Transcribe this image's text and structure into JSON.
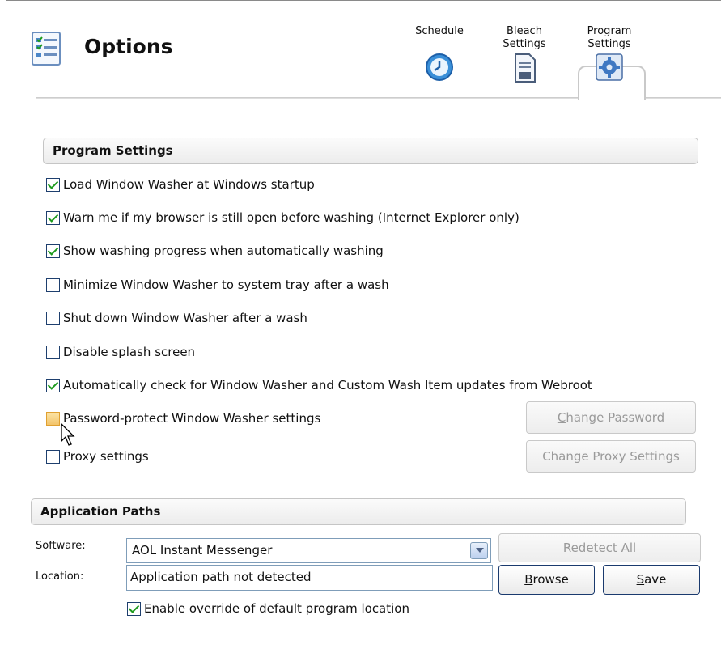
{
  "header": {
    "title": "Options",
    "icon": "options-list-icon"
  },
  "tabs": [
    {
      "label_line1": "Schedule",
      "label_line2": "",
      "icon": "clock-icon"
    },
    {
      "label_line1": "Bleach",
      "label_line2": "Settings",
      "icon": "document-icon"
    },
    {
      "label_line1": "Program",
      "label_line2": "Settings",
      "icon": "gear-icon",
      "selected": true
    }
  ],
  "program_settings": {
    "header": "Program Settings",
    "options": [
      {
        "label": "Load Window Washer at Windows startup",
        "checked": true
      },
      {
        "label": "Warn me if my browser is still open before washing (Internet Explorer only)",
        "checked": true
      },
      {
        "label": "Show washing progress when automatically washing",
        "checked": true
      },
      {
        "label": "Minimize Window Washer to system tray after a wash",
        "checked": false
      },
      {
        "label": "Shut down Window Washer after a wash",
        "checked": false
      },
      {
        "label": "Disable splash screen",
        "checked": false
      },
      {
        "label": "Automatically check for Window Washer and Custom Wash Item updates from Webroot",
        "checked": true
      },
      {
        "label": "Password-protect Window Washer settings",
        "checked": false
      },
      {
        "label": "Proxy settings",
        "checked": false
      }
    ],
    "change_password_button": {
      "access_key": "C",
      "rest": "hange Password"
    },
    "change_proxy_button": "Change Proxy Settings"
  },
  "application_paths": {
    "header": "Application Paths",
    "software_label": "Software:",
    "software_value": "AOL Instant Messenger",
    "location_label": "Location:",
    "location_value": "Application path not detected",
    "redetect_button": {
      "access_key": "R",
      "rest": "edetect All"
    },
    "browse_button": {
      "access_key": "B",
      "rest": "rowse"
    },
    "save_button": {
      "access_key": "S",
      "rest": "ave"
    },
    "override_label": "Enable override of default program location",
    "override_checked": true
  },
  "colors": {
    "checkmark": "#1e9b1e",
    "button_border_enabled": "#1a3a6e",
    "disabled_text": "#9a9a9a"
  }
}
